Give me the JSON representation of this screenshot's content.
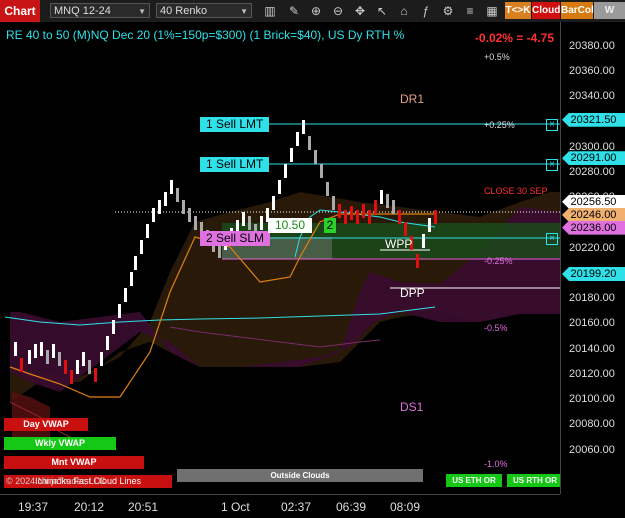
{
  "toolbar": {
    "chart_label": "Chart",
    "instrument": "MNQ 12-24",
    "bar_type": "40 Renko",
    "btn_tk": "T<>K",
    "btn_cloud": "Cloud",
    "btn_barcol": "BarCol",
    "btn_w": "W VWA"
  },
  "header": {
    "title": "RE 40 to 50 (M)NQ Dec 20 (1%=150p=$300) (1 Brick=$40), US Dy RTH %",
    "change": "-0.02% = -4.75"
  },
  "yaxis": {
    "labels": [
      "20380.00",
      "20360.00",
      "20340.00",
      "20320.00",
      "20300.00",
      "20280.00",
      "20260.00",
      "20240.00",
      "20220.00",
      "20200.00",
      "20180.00",
      "20160.00",
      "20140.00",
      "20120.00",
      "20100.00",
      "20080.00",
      "20060.00"
    ],
    "tags": [
      {
        "text": "20321.50",
        "color": "#2fe0e8"
      },
      {
        "text": "20291.00",
        "color": "#2fe0e8"
      },
      {
        "text": "20256.50",
        "color": "#ffffff"
      },
      {
        "text": "20246.00",
        "color": "#f0b070"
      },
      {
        "text": "20236.00",
        "color": "#e070e0"
      },
      {
        "text": "20199.20",
        "color": "#2fe0e8"
      }
    ]
  },
  "xaxis": {
    "labels": [
      "19:37",
      "20:12",
      "20:51",
      "1 Oct",
      "02:37",
      "06:39",
      "08:09"
    ]
  },
  "orders": [
    {
      "label": "1 Sell LMT",
      "price": 20321.5
    },
    {
      "label": "1 Sell LMT",
      "price": 20291.0
    },
    {
      "label": "2 Sell SLM",
      "price": 20236.0
    }
  ],
  "position": {
    "price": "10.50",
    "qty": "2"
  },
  "levels": {
    "dr1": "DR1",
    "wpp": "WPP",
    "dpp": "DPP",
    "ds1": "DS1",
    "close": "CLOSE 30 SEP"
  },
  "percents": {
    "p05": "+0.5%",
    "p025": "+0.25%",
    "m025": "-0.25%",
    "m05": "-0.5%",
    "m1": "-1.0%"
  },
  "vwap": {
    "day": "Day VWAP",
    "wkly": "Wkly VWAP",
    "mnt": "Mnt VWAP"
  },
  "bottom": {
    "copyright": "© 2024 NinjaTrader, LLC",
    "ichimoku": "Ichimoku Fast Cloud Lines",
    "outside": "Outside Clouds",
    "eth": "US ETH OR",
    "rth": "US RTH OR"
  },
  "colors": {
    "accent": "#2fe0e8",
    "up": "#ffffff",
    "down": "#e01010",
    "cloud_top": "#3a2a10",
    "cloud_bottom": "#4a1040",
    "green": "#1a5a1a"
  }
}
